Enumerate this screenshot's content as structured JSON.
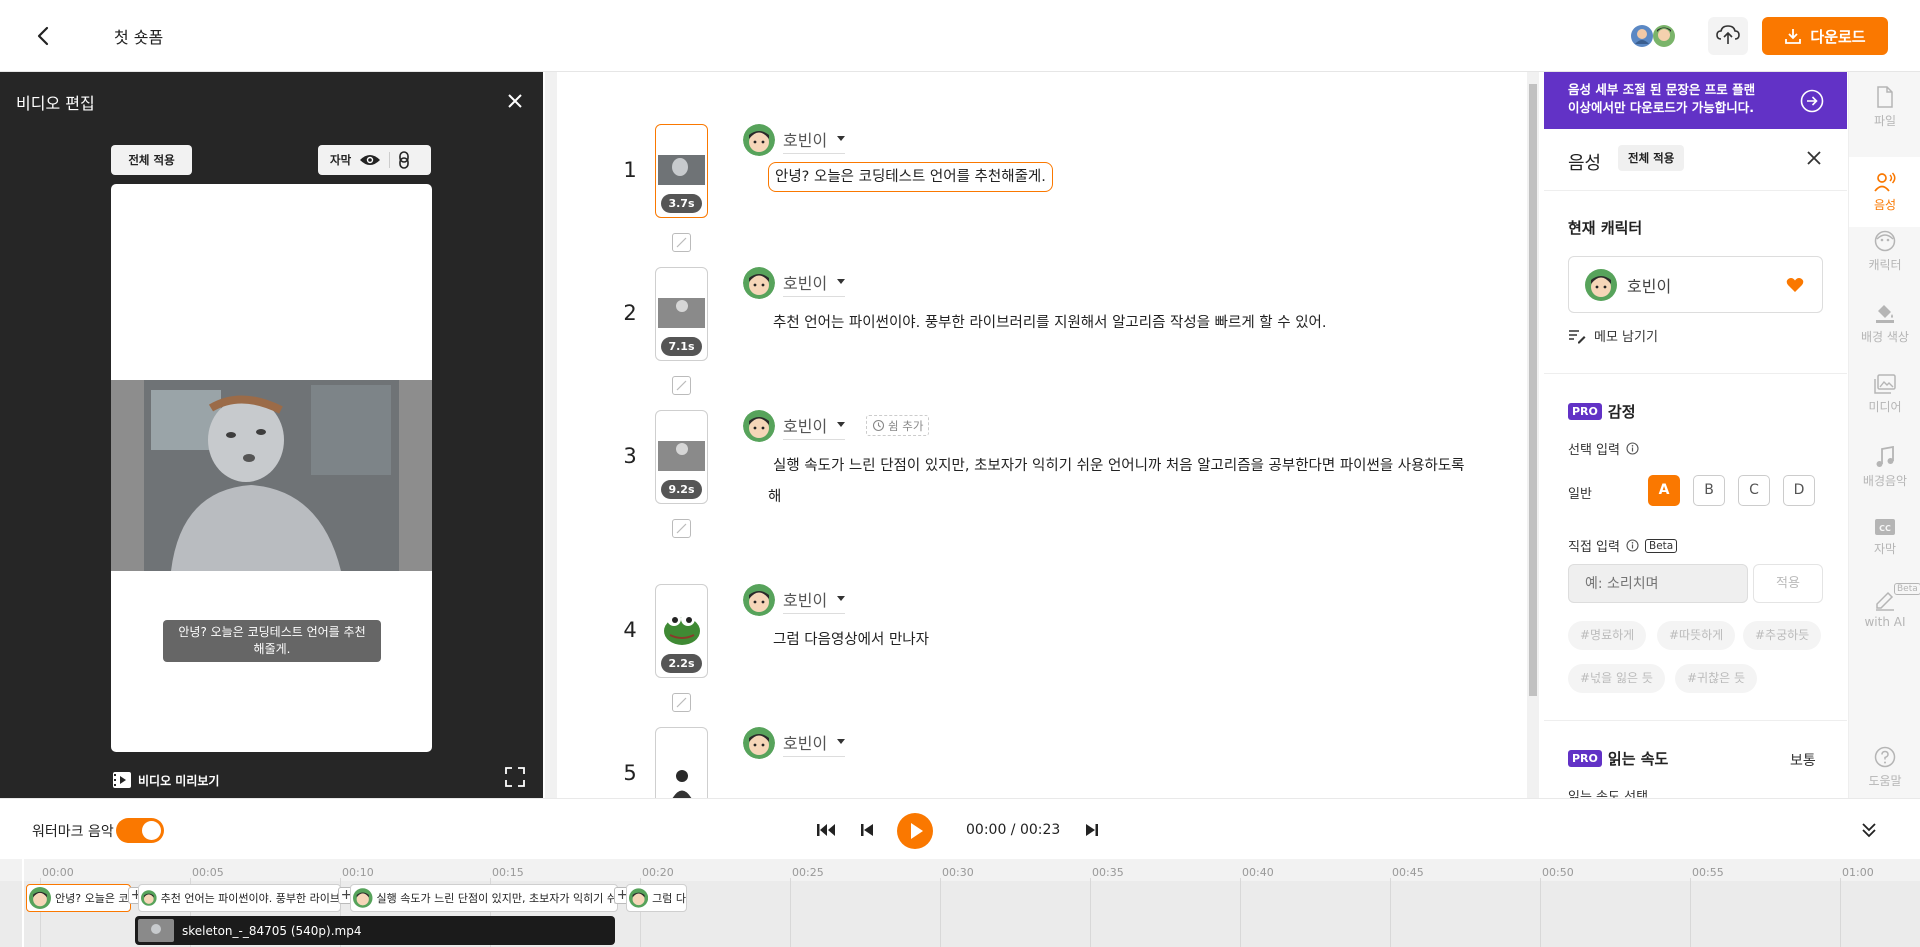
{
  "header": {
    "title": "첫 숏폼",
    "download_label": "다운로드"
  },
  "left_panel": {
    "title": "비디오 편집",
    "apply_all": "전체 적용",
    "subtitle_label": "자막",
    "caption": "안녕? 오늘은 코딩테스트 언어를 추천\n해줄게.",
    "preview_label": "비디오 미리보기"
  },
  "scenes": [
    {
      "number": "1",
      "duration": "3.7s",
      "speaker": "호빈이",
      "text": "안녕? 오늘은 코딩테스트 언어를 추천해줄게."
    },
    {
      "number": "2",
      "duration": "7.1s",
      "speaker": "호빈이",
      "text": "추천 언어는 파이썬이야. 풍부한 라이브러리를 지원해서 알고리즘 작성을 빠르게 할 수 있어."
    },
    {
      "number": "3",
      "duration": "9.2s",
      "speaker": "호빈이",
      "text": "실행 속도가 느린 단점이 있지만,  초보자가 익히기 쉬운 언어니까 처음 알고리즘을 공부한다면 파이썬을 사용하도록",
      "text_cont": "해",
      "rest_label": "쉼 추가"
    },
    {
      "number": "4",
      "duration": "2.2s",
      "speaker": "호빈이",
      "text": "그럼 다음영상에서 만나자"
    },
    {
      "number": "5",
      "duration": "",
      "speaker": "호빈이",
      "text": ""
    }
  ],
  "right_panel": {
    "banner": "음성 세부 조절 된 문장은 프로 플랜\n이상에서만 다운로드가 가능합니다.",
    "title": "음성",
    "apply_all": "전체 적용",
    "current_char_label": "현재 캐릭터",
    "character": "호빈이",
    "memo": "메모 남기기",
    "pro_badge": "PRO",
    "emotion_title": "감정",
    "select_input_label": "선택 입력",
    "normal_label": "일반",
    "options": [
      "A",
      "B",
      "C",
      "D"
    ],
    "selected_option": "A",
    "direct_input_label": "직접 입력",
    "beta": "Beta",
    "direct_placeholder": "예: 소리치며",
    "apply": "적용",
    "tags": [
      "#명료하게",
      "#따뜻하게",
      "#추궁하듯",
      "#넋을 잃은 듯",
      "#귀찮은 듯"
    ],
    "speed_title": "읽는 속도",
    "speed_value": "보통",
    "speed_select_label": "읽는 속도 선택"
  },
  "sidebar": {
    "items": [
      {
        "label": "파일",
        "icon": "file-icon"
      },
      {
        "label": "음성",
        "icon": "voice-icon",
        "active": true
      },
      {
        "label": "캐릭터",
        "icon": "character-icon"
      },
      {
        "label": "배경 색상",
        "icon": "paint-bucket-icon"
      },
      {
        "label": "미디어",
        "icon": "media-icon"
      },
      {
        "label": "배경음악",
        "icon": "music-icon"
      },
      {
        "label": "자막",
        "icon": "cc-icon"
      },
      {
        "label": "with AI",
        "icon": "ai-pen-icon",
        "badge": "Beta"
      },
      {
        "label": "도움말",
        "icon": "help-icon"
      }
    ]
  },
  "transport": {
    "watermark_label": "워터마크 음악",
    "watermark_on": true,
    "time": "00:00 / 00:23"
  },
  "timeline": {
    "ticks": [
      "00:00",
      "00:05",
      "00:10",
      "00:15",
      "00:20",
      "00:25",
      "00:30",
      "00:35",
      "00:40",
      "00:45",
      "00:50",
      "00:55",
      "01:00"
    ],
    "clips": [
      "안녕? 오늘은 코",
      "추천 언어는 파이썬이야. 풍부한 라이브",
      "실행 속도가 느린 단점이 있지만, 초보자가 익히기 쉬",
      "그럼 다"
    ],
    "video_clip": "skeleton_-_84705 (540p).mp4"
  },
  "colors": {
    "accent": "#fa7800",
    "banner": "#6232c6",
    "pro": "#6232c6",
    "dark_panel": "#262626"
  }
}
